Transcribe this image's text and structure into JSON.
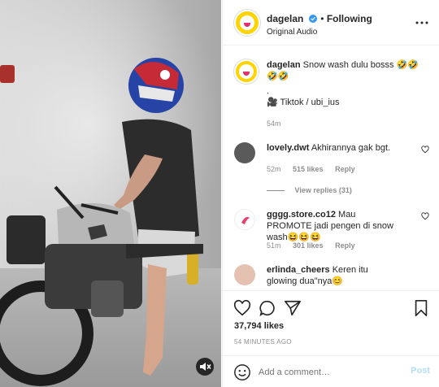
{
  "post": {
    "username": "dagelan",
    "follow_state": "Following",
    "audio": "Original Audio",
    "options_icon": "more-options-icon",
    "verified_icon": "verified-badge-icon"
  },
  "caption": {
    "username": "dagelan",
    "text": "Snow wash dulu bosss 🤣🤣🤣🤣",
    "dot": ".",
    "credit": "🎥 Tiktok / ubi_ius",
    "age": "54m"
  },
  "comments": [
    {
      "username": "lovely.dwt",
      "text": "Akhirannya gak bgt.",
      "age": "52m",
      "likes": "515 likes",
      "reply": "Reply",
      "view_replies": "View replies (31)"
    },
    {
      "username": "gggg.store.co12",
      "text": "Mau PROMOTE jadi pengen di snow wash😆😆😆",
      "age": "51m",
      "likes": "301 likes",
      "reply": "Reply"
    },
    {
      "username": "erlinda_cheers",
      "text": "Keren itu glowing dua\"nya😊",
      "age": "",
      "likes": "",
      "reply": ""
    }
  ],
  "actions": {
    "like_icon": "heart-icon",
    "comment_icon": "comment-icon",
    "share_icon": "share-icon",
    "save_icon": "bookmark-icon",
    "likes": "37,794 likes",
    "timestamp": "54 MINUTES AGO"
  },
  "add_comment": {
    "emoji_icon": "emoji-icon",
    "placeholder": "Add a comment…",
    "post_label": "Post"
  },
  "video": {
    "mute_icon": "speaker-muted-icon"
  },
  "colors": {
    "link": "#0095f6",
    "post_disabled": "#b2dffc",
    "secondary": "#8e8e8e",
    "avatar_brand": "#ffd400"
  }
}
